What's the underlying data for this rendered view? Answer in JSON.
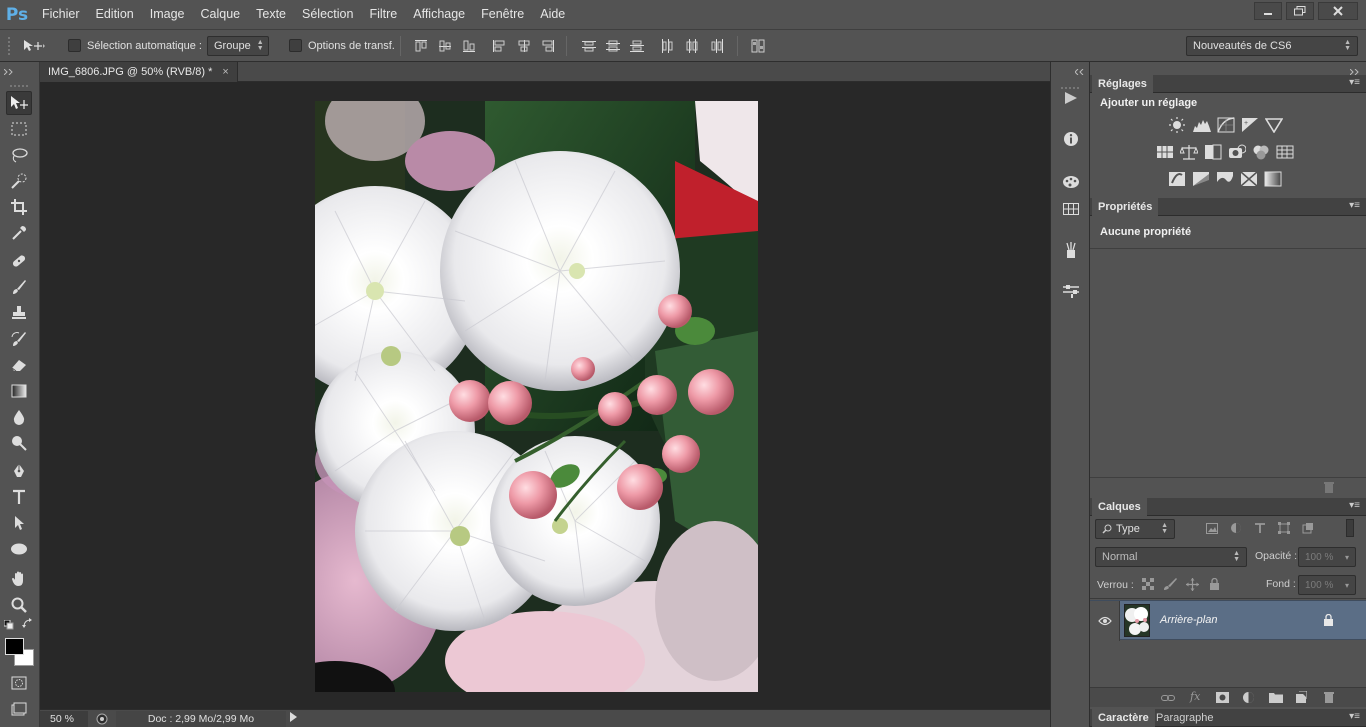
{
  "app": {
    "logo": "Ps"
  },
  "menu": [
    "Fichier",
    "Edition",
    "Image",
    "Calque",
    "Texte",
    "Sélection",
    "Filtre",
    "Affichage",
    "Fenêtre",
    "Aide"
  ],
  "window_controls": [
    "minimize-icon",
    "restore-icon",
    "close-icon"
  ],
  "options": {
    "auto_select_label": "Sélection automatique :",
    "auto_select_value": "Groupe",
    "transform_label": "Options de transf.",
    "workspace": "Nouveautés de CS6"
  },
  "document": {
    "tab_title": "IMG_6806.JPG @ 50% (RVB/8) *",
    "close_glyph": "×"
  },
  "status": {
    "zoom": "50 %",
    "doc_info": "Doc : 2,99 Mo/2,99 Mo"
  },
  "panels": {
    "adjustments": {
      "tab": "Réglages",
      "heading": "Ajouter un réglage"
    },
    "properties": {
      "tab": "Propriétés",
      "text": "Aucune propriété"
    },
    "layers": {
      "tab": "Calques",
      "filter_label": "Type",
      "blend_mode": "Normal",
      "opacity_label": "Opacité :",
      "opacity_value": "100 %",
      "lock_label": "Verrou :",
      "fill_label": "Fond :",
      "fill_value": "100 %",
      "layer_name": "Arrière-plan"
    },
    "bottom_tabs": [
      "Caractère",
      "Paragraphe"
    ]
  },
  "colors": {
    "ui_bg": "#535353",
    "canvas_bg": "#282828",
    "selected_layer": "#5b6e86",
    "ps_blue": "#5fb0e8"
  }
}
